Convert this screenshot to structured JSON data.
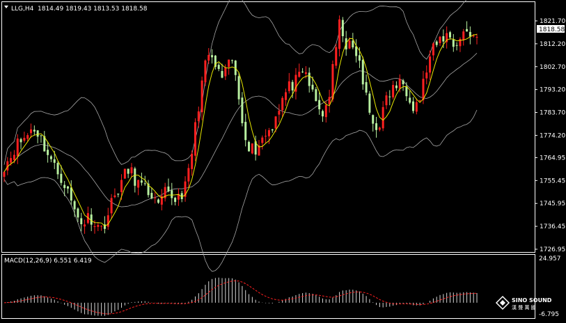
{
  "header": {
    "symbol_tf": "LLG,H4",
    "ohlc": "1814.49 1819.43 1813.53 1818.58",
    "current_price": "1818.58"
  },
  "price_axis": {
    "labels": [
      "1821.70",
      "1812.20",
      "1802.70",
      "1793.20",
      "1783.70",
      "1774.20",
      "1764.95",
      "1755.45",
      "1745.95",
      "1736.45",
      "1726.95"
    ]
  },
  "macd": {
    "label": "MACD(12,26,9) 6.551 6.419",
    "axis_top": "24.957",
    "axis_bottom": "-6.795"
  },
  "logo": {
    "line1": "SINO SOUND",
    "line2": "漢 聲 萬 國"
  },
  "colors": {
    "background": "#000000",
    "bull": "#ff2020",
    "bear": "#b8f0a0",
    "ma": "#e8e800",
    "bands": "#a8a8a8",
    "macd_hist": "#d8d8d8",
    "macd_signal": "#ff2020",
    "text": "#ffffff",
    "border": "#ffffff"
  },
  "chart_data": {
    "type": "candlestick",
    "title": "LLG,H4",
    "y_range": [
      1726.95,
      1828.5
    ],
    "candle_count": 142,
    "indicators": [
      "Bollinger Bands",
      "Moving Average",
      "MACD(12,26,9)"
    ],
    "macd_range": [
      -6.795,
      24.957
    ],
    "close_path": [
      1762,
      1765,
      1770,
      1772,
      1774,
      1778,
      1775,
      1770,
      1765,
      1760,
      1757,
      1752,
      1745,
      1740,
      1738,
      1741,
      1738,
      1735,
      1740,
      1747,
      1752,
      1757,
      1760,
      1756,
      1753,
      1751,
      1750,
      1743,
      1750,
      1749,
      1748,
      1750,
      1753,
      1768,
      1785,
      1800,
      1808,
      1803,
      1798,
      1800,
      1806,
      1792,
      1778,
      1770,
      1768,
      1772,
      1775,
      1778,
      1785,
      1790,
      1794,
      1796,
      1798,
      1800,
      1792,
      1786,
      1783,
      1790,
      1806,
      1822,
      1812,
      1810,
      1808,
      1796,
      1785,
      1777,
      1780,
      1788,
      1793,
      1795,
      1796,
      1792,
      1786,
      1790,
      1800,
      1808,
      1812,
      1815,
      1816,
      1812,
      1814,
      1818,
      1816,
      1815
    ]
  }
}
